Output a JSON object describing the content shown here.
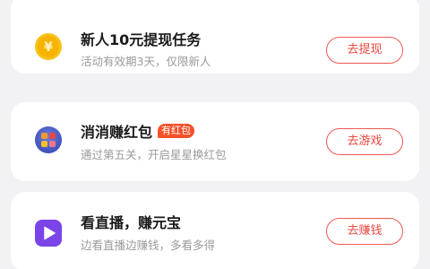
{
  "tasks": [
    {
      "title": "新人10元提现任务",
      "subtitle": "活动有效期3天，仅限新人",
      "button": "去提现",
      "icon": "yuan-coin-icon"
    },
    {
      "title": "消消赚红包",
      "tag": "有红包",
      "subtitle": "通过第五关，开启星星换红包",
      "button": "去游戏",
      "icon": "match-game-icon"
    },
    {
      "title": "看直播，赚元宝",
      "subtitle": "边看直播边赚钱，多看多得",
      "button": "去赚钱",
      "icon": "play-video-icon"
    }
  ],
  "colors": {
    "accent": "#e8483f",
    "tag_bg": "#f4512b",
    "coin": "#f6b400",
    "play": "#7a44e8"
  }
}
